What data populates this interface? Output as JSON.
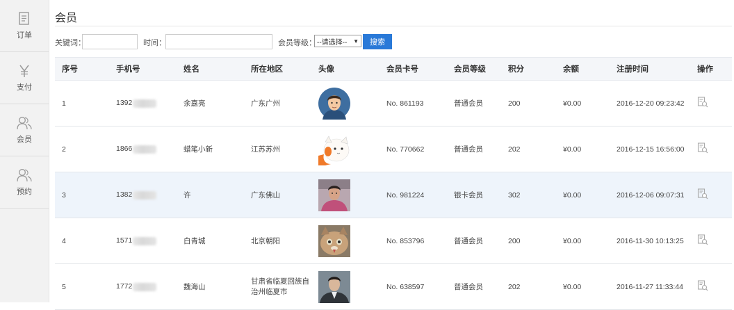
{
  "sidebar": {
    "items": [
      {
        "label": "订单",
        "icon": "document-icon"
      },
      {
        "label": "支付",
        "icon": "yen-icon"
      },
      {
        "label": "会员",
        "icon": "user-icon"
      },
      {
        "label": "预约",
        "icon": "user-icon"
      }
    ]
  },
  "page": {
    "title": "会员"
  },
  "filters": {
    "keyword_label": "关键词：",
    "keyword_value": "",
    "time_label": "时间：",
    "time_value": "",
    "level_label": "会员等级：",
    "level_selected": "--请选择--",
    "search_button": "搜索"
  },
  "table": {
    "headers": [
      "序号",
      "手机号",
      "姓名",
      "所在地区",
      "头像",
      "会员卡号",
      "会员等级",
      "积分",
      "余额",
      "注册时间",
      "操作"
    ],
    "rows": [
      {
        "no": "1",
        "phone": "1392",
        "name": "余嘉亮",
        "region": "广东广州",
        "card": "No. 861193",
        "level": "普通会员",
        "points": "200",
        "balance": "¥0.00",
        "time": "2016-12-20 09:23:42",
        "avatar": "cartoon-man"
      },
      {
        "no": "2",
        "phone": "1866",
        "name": "蜡笔小新",
        "region": "江苏苏州",
        "card": "No. 770662",
        "level": "普通会员",
        "points": "202",
        "balance": "¥0.00",
        "time": "2016-12-15 16:56:00",
        "avatar": "cartoon-cat"
      },
      {
        "no": "3",
        "phone": "1382",
        "name": "许",
        "region": "广东佛山",
        "card": "No. 981224",
        "level": "银卡会员",
        "points": "302",
        "balance": "¥0.00",
        "time": "2016-12-06 09:07:31",
        "avatar": "photo-man"
      },
      {
        "no": "4",
        "phone": "1571",
        "name": "白青城",
        "region": "北京朝阳",
        "card": "No. 853796",
        "level": "普通会员",
        "points": "200",
        "balance": "¥0.00",
        "time": "2016-11-30 10:13:25",
        "avatar": "photo-cat"
      },
      {
        "no": "5",
        "phone": "1772",
        "name": "魏海山",
        "region": "甘肃省临夏回族自治州临夏市",
        "card": "No. 638597",
        "level": "普通会员",
        "points": "202",
        "balance": "¥0.00",
        "time": "2016-11-27 11:33:44",
        "avatar": "photo-suit"
      }
    ]
  },
  "colors": {
    "accent": "#2979d8",
    "highlight_row": "#eef4fb",
    "header_bg": "#f4f6f9",
    "sidebar_bg": "#f2f2f2"
  }
}
